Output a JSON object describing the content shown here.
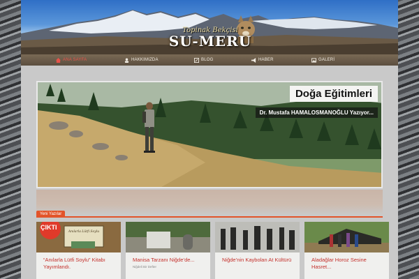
{
  "site": {
    "logo_top": "Topinak Bekçisi",
    "logo_main": "SU-MERU"
  },
  "nav": [
    {
      "label": "ANA SAYFA",
      "icon": "home-icon",
      "active": true
    },
    {
      "label": "HAKKIMIZDA",
      "icon": "user-icon",
      "active": false
    },
    {
      "label": "BLOG",
      "icon": "edit-icon",
      "active": false
    },
    {
      "label": "HABER",
      "icon": "megaphone-icon",
      "active": false
    },
    {
      "label": "GALERİ",
      "icon": "image-icon",
      "active": false
    }
  ],
  "hero": {
    "title": "Doğa Eğitimleri",
    "subtitle": "Dr. Mustafa HAMALOSMANOĞLU Yazıyor..."
  },
  "latest": {
    "label": "Yeni Yazılar",
    "cards": [
      {
        "title": "“Anılarla Lütfi Soylu” Kitabı Yayımlandı.",
        "meta": "",
        "badge": "ÇIKTI",
        "sign": "Anılarla Lütfi Soylu"
      },
      {
        "title": "Manisa Tarzanı Niğde’de...",
        "meta": "Niğdeli Bir Defter"
      },
      {
        "title": "Niğde’nin Kaybolan At Kültürü",
        "meta": ""
      },
      {
        "title": "Aladağlar Horoz Sesine Hasret...",
        "meta": ""
      }
    ]
  },
  "colors": {
    "accent": "#e2542a",
    "link": "#c4302b",
    "nav_active": "#e6534a"
  }
}
